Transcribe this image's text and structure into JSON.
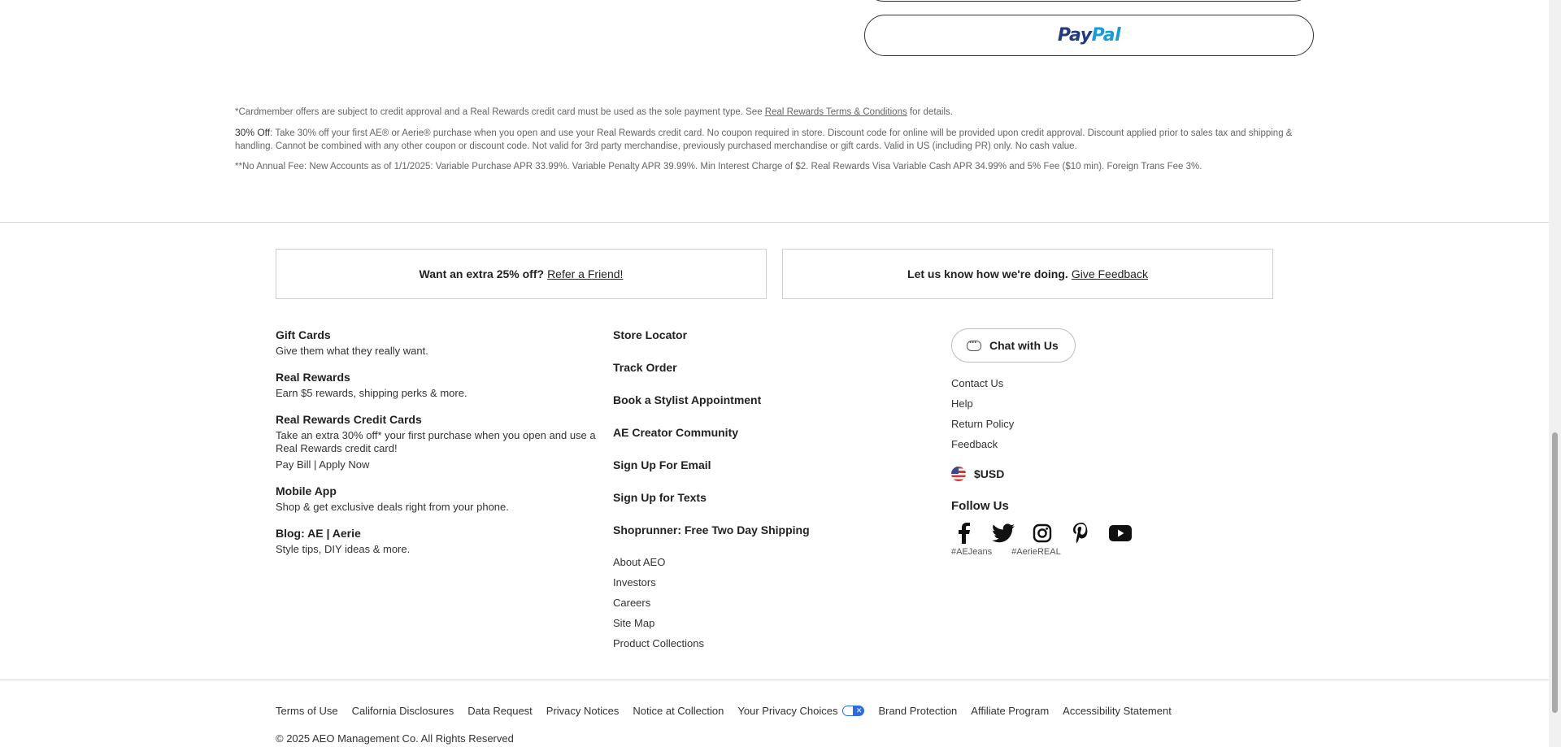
{
  "payment": {
    "paypal_logo_a": "Pay",
    "paypal_logo_b": "Pal"
  },
  "disclaimer": {
    "line1_prefix": "*Cardmember offers are subject to credit approval and a Real Rewards credit card must be used as the sole payment type. See ",
    "line1_link": "Real Rewards Terms & Conditions",
    "line1_suffix": " for details.",
    "line2_strong": "30% Off",
    "line2_text": ": Take 30% off your first AE® or Aerie® purchase when you open and use your Real Rewards credit card. No coupon required in store. Discount code for online will be provided upon credit approval. Discount applied prior to sales tax and shipping & handling. Cannot be combined with any other coupon or discount code. Not valid for 3rd party merchandise, previously purchased merchandise or gift cards. Valid in US (including PR) only. No cash value.",
    "line3": "**No Annual Fee: New Accounts as of 1/1/2025: Variable Purchase APR 33.99%. Variable Penalty APR 39.99%. Min Interest Charge of $2. Real Rewards Visa Variable Cash APR 34.99% and 5% Fee ($10 min). Foreign Trans Fee 3%."
  },
  "promos": {
    "refer_text": "Want an extra 25% off?",
    "refer_link": "Refer a Friend!",
    "feedback_text": "Let us know how we're doing.",
    "feedback_link": "Give Feedback"
  },
  "col1": [
    {
      "title": "Gift Cards",
      "desc": "Give them what they really want."
    },
    {
      "title": "Real Rewards",
      "desc": "Earn $5 rewards, shipping perks & more."
    },
    {
      "title": "Real Rewards Credit Cards",
      "desc": "Take an extra 30% off* your first purchase when you open and use a Real Rewards credit card!",
      "sub": "Pay Bill | Apply Now"
    },
    {
      "title": "Mobile App",
      "desc": "Shop & get exclusive deals right from your phone."
    },
    {
      "title": "Blog: AE | Aerie",
      "desc": "Style tips, DIY ideas & more."
    }
  ],
  "col2": {
    "bold_links": [
      "Store Locator",
      "Track Order",
      "Book a Stylist Appointment",
      "AE Creator Community",
      "Sign Up For Email",
      "Sign Up for Texts",
      "Shoprunner: Free Two Day Shipping"
    ],
    "small_links": [
      "About AEO",
      "Investors",
      "Careers",
      "Site Map",
      "Product Collections"
    ]
  },
  "col3": {
    "chat_label": "Chat with Us",
    "links": [
      "Contact Us",
      "Help",
      "Return Policy",
      "Feedback"
    ],
    "currency": "$USD",
    "follow_title": "Follow Us",
    "socials": [
      "facebook-icon",
      "twitter-icon",
      "instagram-icon",
      "pinterest-icon",
      "youtube-icon"
    ],
    "hashtags": [
      "#AEJeans",
      "#AerieREAL"
    ]
  },
  "legal": {
    "links": [
      "Terms of Use",
      "California Disclosures",
      "Data Request",
      "Privacy Notices",
      "Notice at Collection",
      "Your Privacy Choices",
      "Brand Protection",
      "Affiliate Program",
      "Accessibility Statement"
    ],
    "copyright": "© 2025 AEO Management Co. All Rights Reserved"
  }
}
